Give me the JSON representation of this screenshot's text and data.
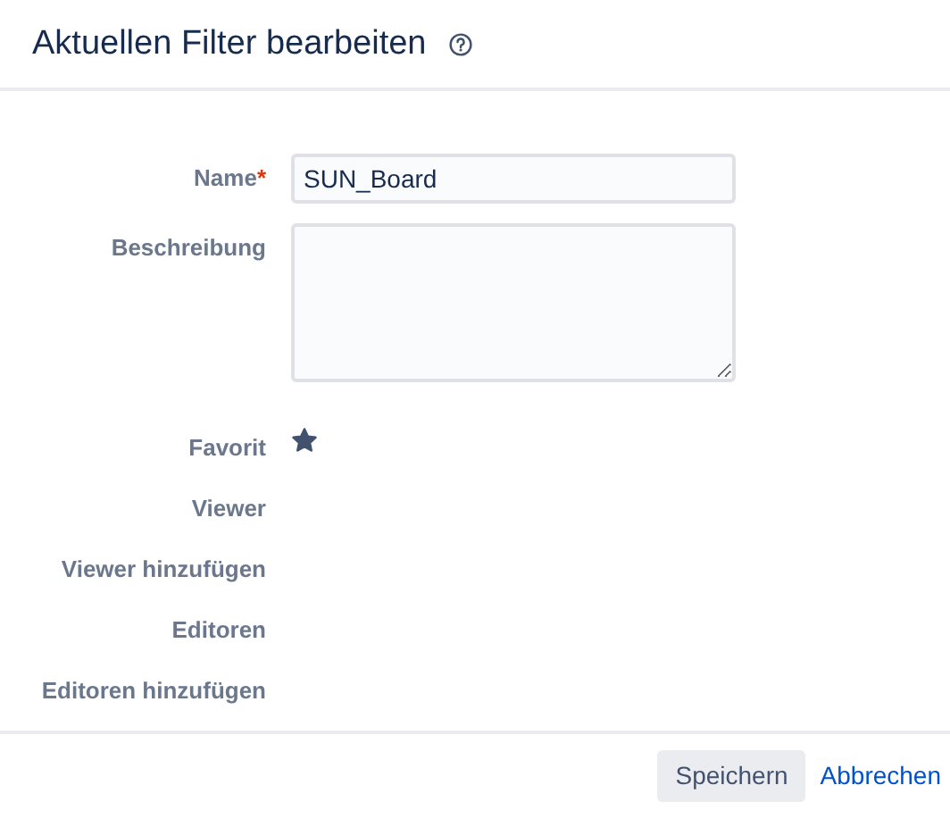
{
  "dialog": {
    "title": "Aktuellen Filter bearbeiten"
  },
  "fields": [
    {
      "kind": "text",
      "label": "Name",
      "required_mark": "*",
      "value": "SUN_Board"
    },
    {
      "kind": "textarea",
      "label": "Beschreibung"
    },
    {
      "kind": "star",
      "label": "Favorit",
      "checked": true
    },
    {
      "kind": "empty",
      "label": "Viewer"
    },
    {
      "kind": "empty",
      "label": "Viewer hinzufügen"
    },
    {
      "kind": "empty",
      "label": "Editoren"
    },
    {
      "kind": "empty",
      "label": "Editoren hinzufügen"
    }
  ],
  "buttons": [
    {
      "kind": "primary",
      "label": "Speichern"
    },
    {
      "kind": "link",
      "label": "Abbrechen"
    }
  ]
}
